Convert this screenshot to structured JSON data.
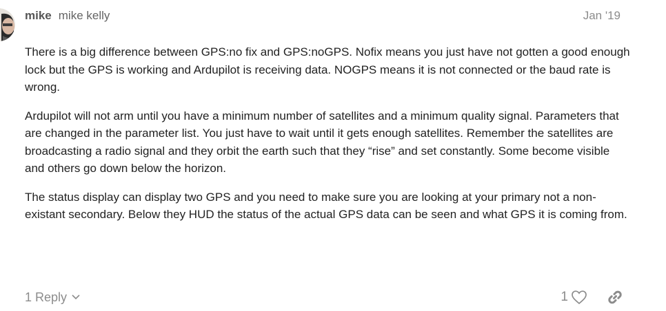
{
  "post": {
    "username": "mike",
    "full_name": "mike kelly",
    "date": "Jan '19",
    "paragraphs": [
      "There is a big difference between GPS:no fix and GPS:noGPS. Nofix means you just have not gotten a good enough lock but the GPS is working and Ardupilot is receiving data. NOGPS means it is not connected or the baud rate is wrong.",
      "Ardupilot will not arm until you have a minimum number of satellites and a minimum quality signal. Parameters that are changed in the parameter list. You just have to wait until it gets enough satellites. Remember the satellites are broadcasting a radio signal and they orbit the earth such that they “rise” and set constantly. Some become visible and others go down below the horizon.",
      "The status display can display two GPS and you need to make sure you are looking at your primary not a non-existant secondary. Below they HUD the status of the actual GPS data can be seen and what GPS it is coming from."
    ]
  },
  "footer": {
    "replies_label": "1 Reply",
    "like_count": "1"
  },
  "icons": {
    "avatar": "avatar",
    "replies_toggle": "chevron-down-icon",
    "like": "heart-icon",
    "share": "link-icon"
  },
  "colors": {
    "text": "#222222",
    "muted": "#8c8c8c",
    "username": "#555555"
  }
}
